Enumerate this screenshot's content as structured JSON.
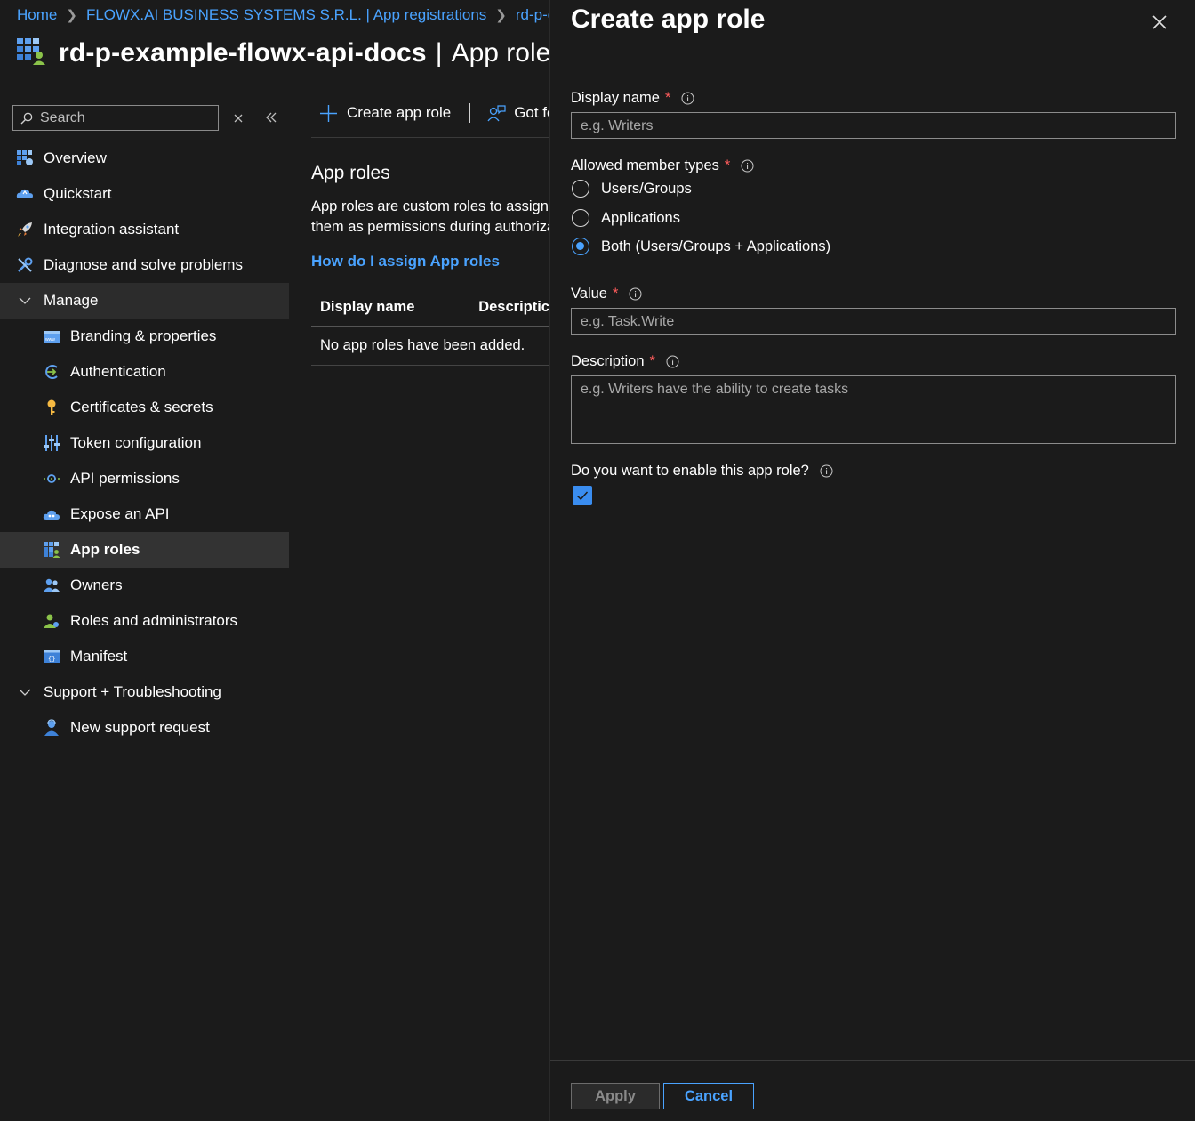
{
  "breadcrumb": {
    "items": [
      "Home",
      "FLOWX.AI BUSINESS SYSTEMS S.R.L. | App registrations",
      "rd-p-exar"
    ]
  },
  "page": {
    "title": "rd-p-example-flowx-api-docs",
    "title_sep": "|",
    "subtitle": "App roles"
  },
  "search": {
    "placeholder": "Search"
  },
  "sidebar": {
    "items": [
      {
        "label": "Overview",
        "icon": "overview-grid-icon"
      },
      {
        "label": "Quickstart",
        "icon": "cloud-quickstart-icon"
      },
      {
        "label": "Integration assistant",
        "icon": "rocket-icon"
      },
      {
        "label": "Diagnose and solve problems",
        "icon": "wrench-icon"
      },
      {
        "label": "Manage",
        "icon": "chevron-down-icon"
      },
      {
        "label": "Branding & properties",
        "icon": "www-icon"
      },
      {
        "label": "Authentication",
        "icon": "authentication-arrow-icon"
      },
      {
        "label": "Certificates & secrets",
        "icon": "key-icon"
      },
      {
        "label": "Token configuration",
        "icon": "sliders-icon"
      },
      {
        "label": "API permissions",
        "icon": "api-permissions-icon"
      },
      {
        "label": "Expose an API",
        "icon": "cloud-api-icon"
      },
      {
        "label": "App roles",
        "icon": "app-roles-grid-icon"
      },
      {
        "label": "Owners",
        "icon": "people-icon"
      },
      {
        "label": "Roles and administrators",
        "icon": "admin-person-icon"
      },
      {
        "label": "Manifest",
        "icon": "manifest-braces-icon"
      },
      {
        "label": "Support + Troubleshooting",
        "icon": "chevron-down-icon"
      },
      {
        "label": "New support request",
        "icon": "support-person-icon"
      }
    ],
    "selected": "App roles"
  },
  "toolbar": {
    "create_label": "Create app role",
    "feedback_label": "Got fe"
  },
  "section": {
    "title": "App roles",
    "desc_line1": "App roles are custom roles to assign",
    "desc_line2": "them as permissions during authoriza",
    "link": "How do I assign App roles"
  },
  "table": {
    "columns": [
      "Display name",
      "Descriptic"
    ],
    "empty_message": "No app roles have been added."
  },
  "panel": {
    "title": "Create app role",
    "display_name": {
      "label": "Display name",
      "placeholder": "e.g. Writers",
      "value": ""
    },
    "member_types": {
      "label": "Allowed member types",
      "options": [
        "Users/Groups",
        "Applications",
        "Both (Users/Groups + Applications)"
      ],
      "selected": "Both (Users/Groups + Applications)"
    },
    "value_field": {
      "label": "Value",
      "placeholder": "e.g. Task.Write",
      "value": ""
    },
    "description": {
      "label": "Description",
      "placeholder": "e.g. Writers have the ability to create tasks",
      "value": ""
    },
    "enable": {
      "label": "Do you want to enable this app role?",
      "checked": true
    },
    "required_mark": "*",
    "apply_label": "Apply",
    "cancel_label": "Cancel"
  },
  "colors": {
    "background": "#1b1b1b",
    "link": "#4aa3ff",
    "required": "#ff5c5c",
    "checkbox": "#3a8df0",
    "selected_nav": "#333333"
  }
}
